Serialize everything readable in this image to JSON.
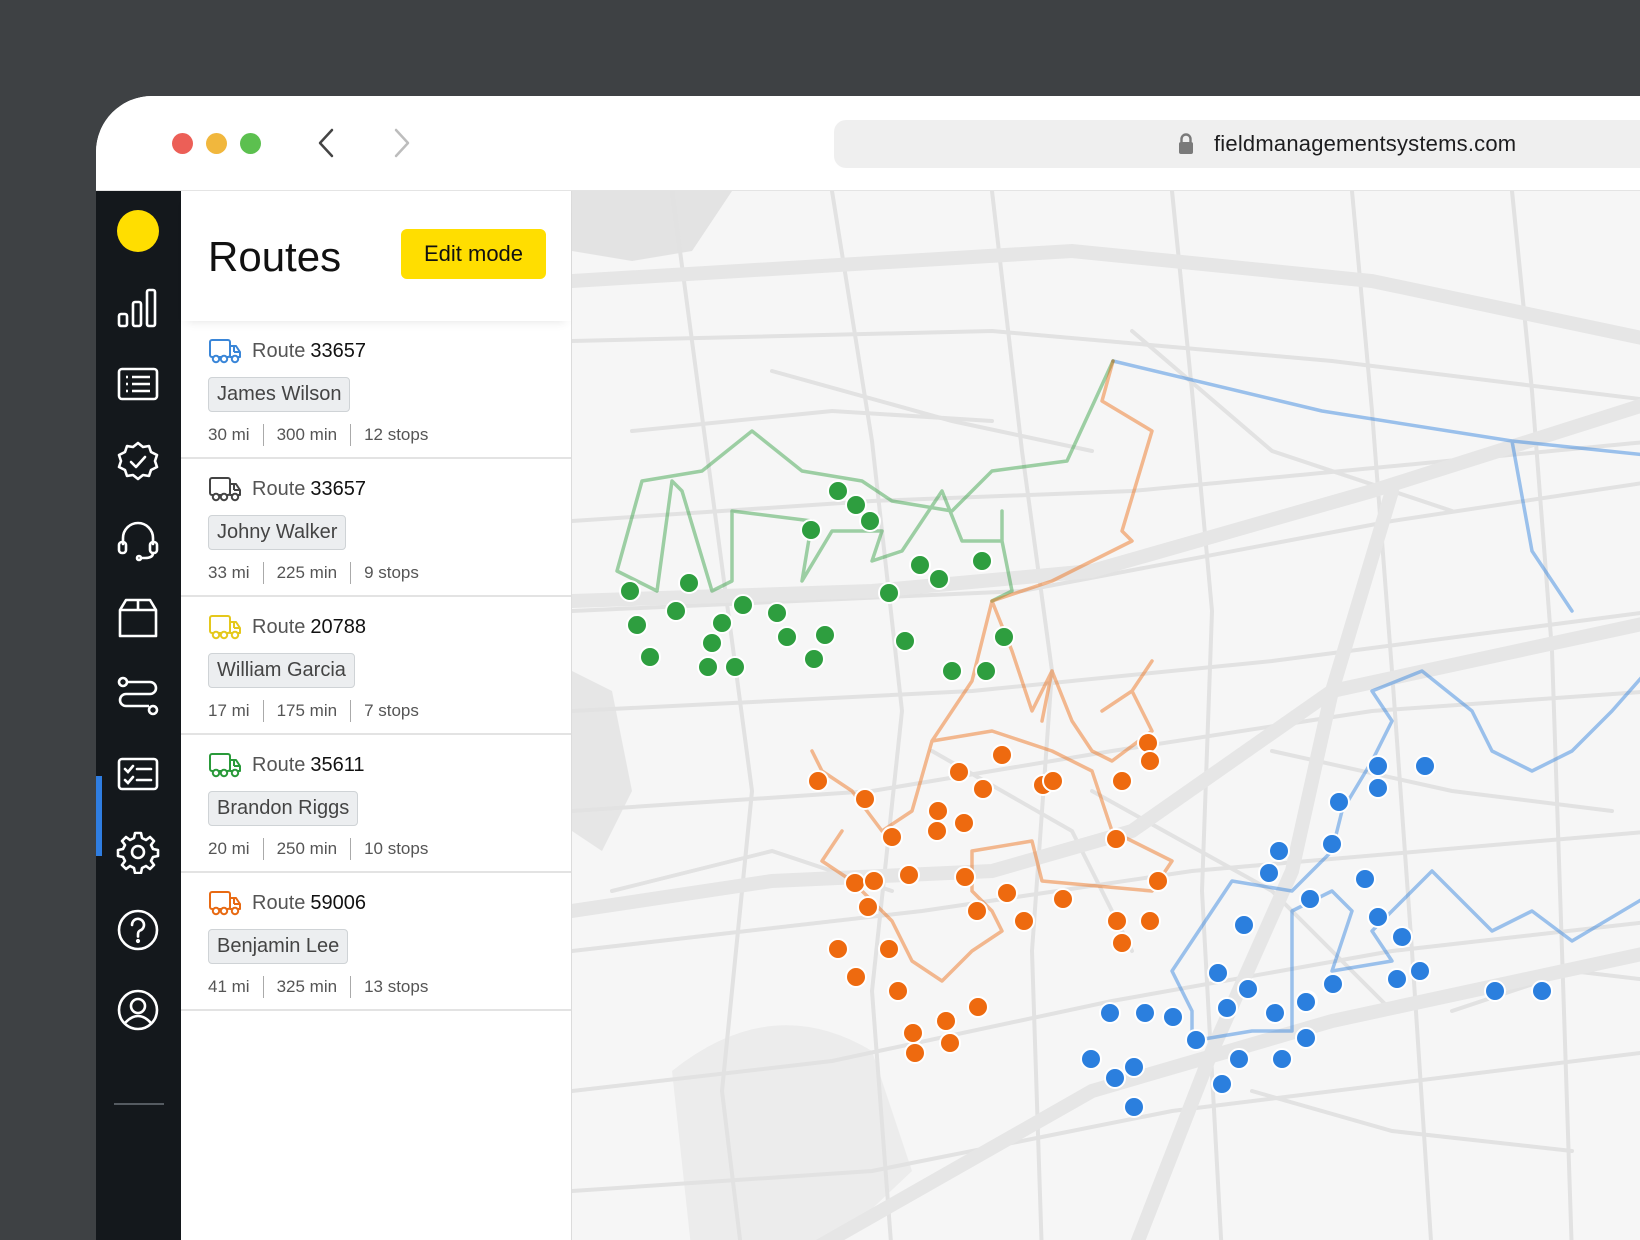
{
  "browser": {
    "url": "fieldmanagementsystems.com"
  },
  "sidebar": {
    "items": [
      {
        "name": "analytics-icon"
      },
      {
        "name": "list-icon"
      },
      {
        "name": "verified-badge-icon"
      },
      {
        "name": "headset-icon"
      },
      {
        "name": "box-icon"
      },
      {
        "name": "routes-icon",
        "active": true
      },
      {
        "name": "checklist-icon"
      },
      {
        "name": "gear-icon"
      },
      {
        "name": "help-icon"
      },
      {
        "name": "profile-icon"
      }
    ],
    "accent_color": "#2f7de1",
    "logo_color": "#ffde00"
  },
  "panel": {
    "title": "Routes",
    "edit_button": "Edit mode"
  },
  "routes": [
    {
      "label": "Route",
      "number": "33657",
      "driver": "James Wilson",
      "distance": "30 mi",
      "duration": "300 min",
      "stops": "12 stops",
      "color": "#3a86d8"
    },
    {
      "label": "Route",
      "number": "33657",
      "driver": "Johny Walker",
      "distance": "33 mi",
      "duration": "225 min",
      "stops": "9 stops",
      "color": "#444444"
    },
    {
      "label": "Route",
      "number": "20788",
      "driver": "William Garcia",
      "distance": "17 mi",
      "duration": "175 min",
      "stops": "7 stops",
      "color": "#e5c81c"
    },
    {
      "label": "Route",
      "number": "35611",
      "driver": "Brandon Riggs",
      "distance": "20 mi",
      "duration": "250 min",
      "stops": "10 stops",
      "color": "#2a9a3a"
    },
    {
      "label": "Route",
      "number": "59006",
      "driver": "Benjamin Lee",
      "distance": "41 mi",
      "duration": "325 min",
      "stops": "13 stops",
      "color": "#e86a13"
    }
  ],
  "map": {
    "route_colors": {
      "green": "#2e9e3f",
      "orange": "#ee6a0f",
      "blue": "#2b7fde"
    }
  }
}
